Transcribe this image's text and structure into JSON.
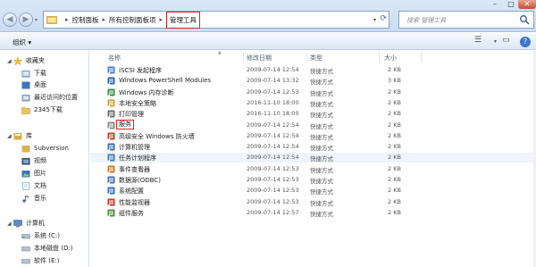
{
  "address": {
    "crumbs": [
      "控制面板",
      "所有控制面板项"
    ],
    "current": "管理工具"
  },
  "search": {
    "placeholder": "搜索 管理工具"
  },
  "toolbar": {
    "organize": "组织 ▾"
  },
  "sidebar": {
    "favorites": {
      "label": "收藏夹",
      "items": [
        "下载",
        "桌面",
        "最近访问的位置",
        "2345下载"
      ]
    },
    "libraries": {
      "label": "库",
      "items": [
        "Subversion",
        "视频",
        "图片",
        "文档",
        "音乐"
      ]
    },
    "computer": {
      "label": "计算机",
      "items": [
        "系统 (C:)",
        "本地磁盘 (D:)",
        "软件 (E:)"
      ]
    }
  },
  "columns": {
    "name": "名称",
    "date": "修改日期",
    "type": "类型",
    "size": "大小"
  },
  "files": [
    {
      "name": "iSCSI 发起程序",
      "date": "2009-07-14 12:54",
      "type": "快捷方式",
      "size": "2 KB",
      "icon": "iscsi-icon",
      "color": "#4a7fc1"
    },
    {
      "name": "Windows PowerShell Modules",
      "date": "2009-07-14 13:32",
      "type": "快捷方式",
      "size": "3 KB",
      "icon": "powershell-icon",
      "color": "#2b5fa8"
    },
    {
      "name": "Windows 内存诊断",
      "date": "2009-07-14 12:53",
      "type": "快捷方式",
      "size": "2 KB",
      "icon": "memory-diagnostic-icon",
      "color": "#3d8a4a"
    },
    {
      "name": "本地安全策略",
      "date": "2016-11-10 18:00",
      "type": "快捷方式",
      "size": "2 KB",
      "icon": "security-policy-icon",
      "color": "#c7a23a"
    },
    {
      "name": "打印管理",
      "date": "2016-11-10 18:00",
      "type": "快捷方式",
      "size": "2 KB",
      "icon": "printer-icon",
      "color": "#6a6a6a"
    },
    {
      "name": "服务",
      "date": "2009-07-14 12:54",
      "type": "快捷方式",
      "size": "2 KB",
      "icon": "services-icon",
      "color": "#8a8a8a",
      "highlight": true
    },
    {
      "name": "高级安全 Windows 防火墙",
      "date": "2009-07-14 12:54",
      "type": "快捷方式",
      "size": "2 KB",
      "icon": "firewall-icon",
      "color": "#b0462a"
    },
    {
      "name": "计算机管理",
      "date": "2009-07-14 12:54",
      "type": "快捷方式",
      "size": "2 KB",
      "icon": "computer-management-icon",
      "color": "#3b6fa8"
    },
    {
      "name": "任务计划程序",
      "date": "2009-07-14 12:54",
      "type": "快捷方式",
      "size": "2 KB",
      "icon": "task-scheduler-icon",
      "color": "#3b79b6"
    },
    {
      "name": "事件查看器",
      "date": "2009-07-14 12:53",
      "type": "快捷方式",
      "size": "2 KB",
      "icon": "event-viewer-icon",
      "color": "#c47a1f"
    },
    {
      "name": "数据源(ODBC)",
      "date": "2009-07-14 12:53",
      "type": "快捷方式",
      "size": "2 KB",
      "icon": "odbc-icon",
      "color": "#4a6fa0"
    },
    {
      "name": "系统配置",
      "date": "2009-07-14 12:53",
      "type": "快捷方式",
      "size": "2 KB",
      "icon": "system-config-icon",
      "color": "#2f6db0"
    },
    {
      "name": "性能监视器",
      "date": "2009-07-14 12:53",
      "type": "快捷方式",
      "size": "2 KB",
      "icon": "performance-monitor-icon",
      "color": "#c23a2a"
    },
    {
      "name": "组件服务",
      "date": "2009-07-14 12:57",
      "type": "快捷方式",
      "size": "2 KB",
      "icon": "component-services-icon",
      "color": "#4a8a3a"
    }
  ]
}
